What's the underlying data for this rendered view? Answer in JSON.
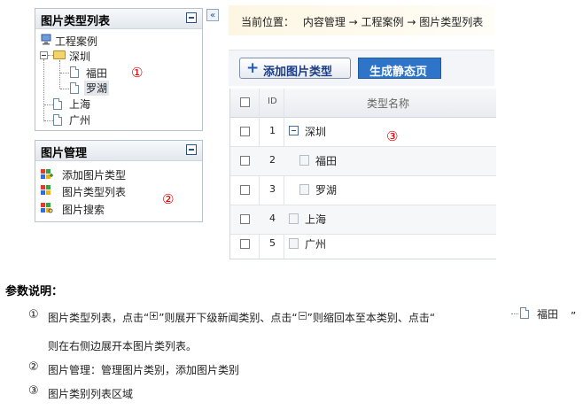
{
  "panel1": {
    "title": "图片类型列表",
    "tree": {
      "root": "工程案例",
      "shenzhen": "深圳",
      "futian": "福田",
      "luohu": "罗湖",
      "shanghai": "上海",
      "guangzhou": "广州"
    },
    "marker": "①"
  },
  "panel2": {
    "title": "图片管理",
    "items": [
      "添加图片类型",
      "图片类型列表",
      "图片搜索"
    ],
    "marker": "②"
  },
  "toggle": "«",
  "location": {
    "label": "当前位置：",
    "path": "内容管理 → 工程案例 → 图片类型列表"
  },
  "toolbar": {
    "add_label": "添加图片类型",
    "generate_label": "生成静态页"
  },
  "grid": {
    "headers": {
      "id": "ID",
      "name": "类型名称"
    },
    "marker": "③",
    "rows": [
      {
        "id": "1",
        "name": "深圳"
      },
      {
        "id": "2",
        "name": "福田"
      },
      {
        "id": "3",
        "name": "罗湖"
      },
      {
        "id": "4",
        "name": "上海"
      },
      {
        "id": "5",
        "name": "广州"
      }
    ]
  },
  "doc": {
    "heading": "参数说明：",
    "n1": "①",
    "line1_a": "图片类型列表，点击“",
    "line1_b": "”则展开下级新闻类别、点击“",
    "line1_c": "”则缩回本至本类别、点击“",
    "line1_d": "”",
    "sample_node": "福田",
    "line1_cont": "则在右侧边展开本图片类列表。",
    "n2": "②",
    "line2": "图片管理：管理图片类别，添加图片类别",
    "n3": "③",
    "line3": "图片类别列表区域"
  }
}
